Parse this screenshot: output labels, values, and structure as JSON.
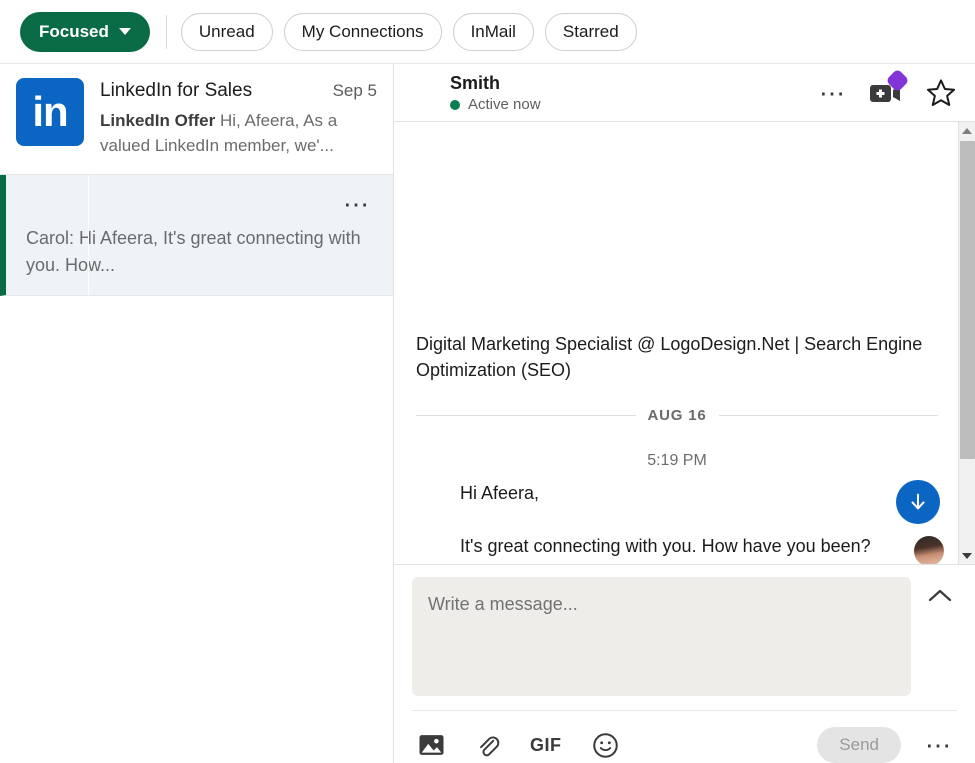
{
  "filter_bar": {
    "focused": {
      "label": "Focused",
      "icon": "chevron-down-icon"
    },
    "pills": [
      {
        "label": "Unread"
      },
      {
        "label": "My Connections"
      },
      {
        "label": "InMail"
      },
      {
        "label": "Starred"
      }
    ]
  },
  "conversations": [
    {
      "avatar_text": "in",
      "avatar_color": "#0a66c2",
      "name": "LinkedIn for Sales",
      "date": "Sep 5",
      "snippet_bold": "LinkedIn Offer",
      "snippet": "Hi, Afeera, As a valued LinkedIn member, we'...",
      "selected": false
    },
    {
      "preview": "Carol: Hi Afeera, It's great connecting with you. How...",
      "overflow_icon": "more-horizontal-icon",
      "selected": true
    }
  ],
  "thread": {
    "name": "Smith",
    "status": "Active now",
    "status_color": "#0a7d51",
    "actions": {
      "more": "more-horizontal-icon",
      "video": "video-add-icon",
      "video_badge_color": "#8334d6",
      "star": "star-outline-icon"
    },
    "headline": "Digital Marketing Specialist @ LogoDesign.Net | Search Engine Optimization (SEO)",
    "date_separator": "AUG 16",
    "message_time": "5:19 PM",
    "message_lines": [
      "Hi Afeera,",
      "It's great connecting with you. How have you been?"
    ],
    "scroll_down_icon": "arrow-down-icon",
    "scroll_down_color": "#0a66c2"
  },
  "composer": {
    "placeholder": "Write a message...",
    "value": "",
    "collapse_icon": "chevron-up-icon",
    "tools": [
      {
        "name": "image-icon",
        "label": ""
      },
      {
        "name": "attachment-icon",
        "label": ""
      },
      {
        "name": "gif-icon",
        "label": "GIF"
      },
      {
        "name": "emoji-icon",
        "label": ""
      }
    ],
    "send_label": "Send",
    "overflow_icon": "more-horizontal-icon"
  },
  "scrollbar": {
    "up_icon": "triangle-up-icon",
    "down_icon": "triangle-down-icon"
  }
}
